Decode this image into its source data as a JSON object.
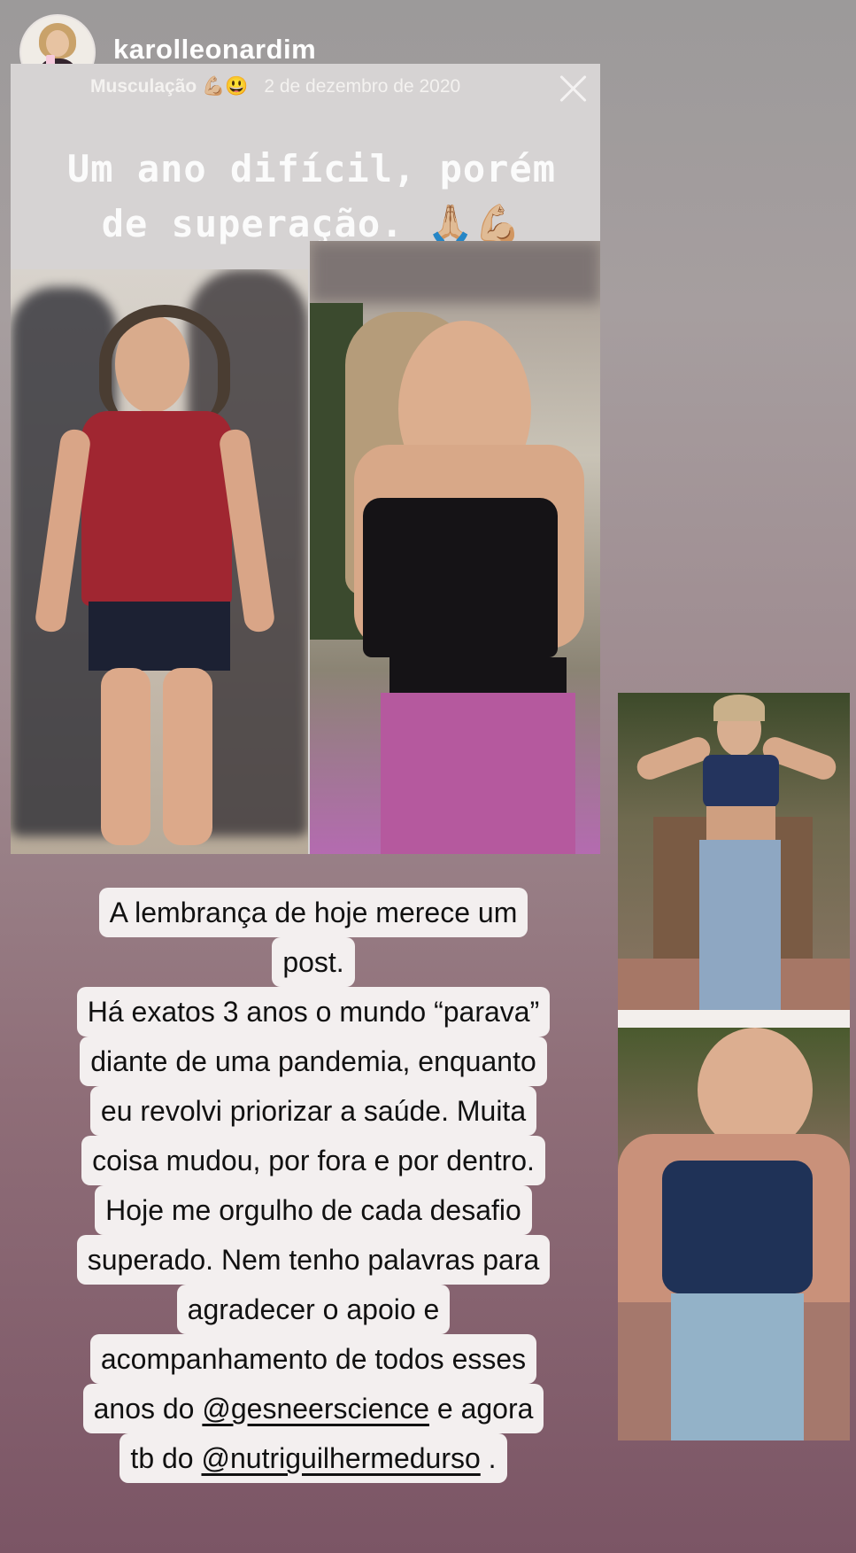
{
  "header": {
    "username": "karolleonardim",
    "close_icon": "close-icon"
  },
  "memory": {
    "category": "Musculação 💪🏼😃",
    "date": "2 de dezembro de 2020",
    "title_line1": "Um ano difícil, porém",
    "title_line2": "de superação. 🙏🏼💪🏼"
  },
  "caption": {
    "lines": [
      "A lembrança de hoje merece um",
      "post.",
      "Há exatos 3 anos o mundo “parava”",
      "diante de uma pandemia, enquanto",
      "eu revolvi priorizar a saúde. Muita",
      "coisa mudou, por fora e por dentro.",
      "Hoje me orgulho de cada desafio",
      "superado. Nem tenho palavras para",
      "agradecer o apoio e",
      "acompanhamento de todos esses"
    ],
    "line11_prefix": "anos do ",
    "mention1": "@gesneerscience",
    "line11_suffix": " e agora",
    "line12_prefix": "tb do ",
    "mention2": "@nutriguilhermedurso",
    "line12_suffix": " ."
  }
}
